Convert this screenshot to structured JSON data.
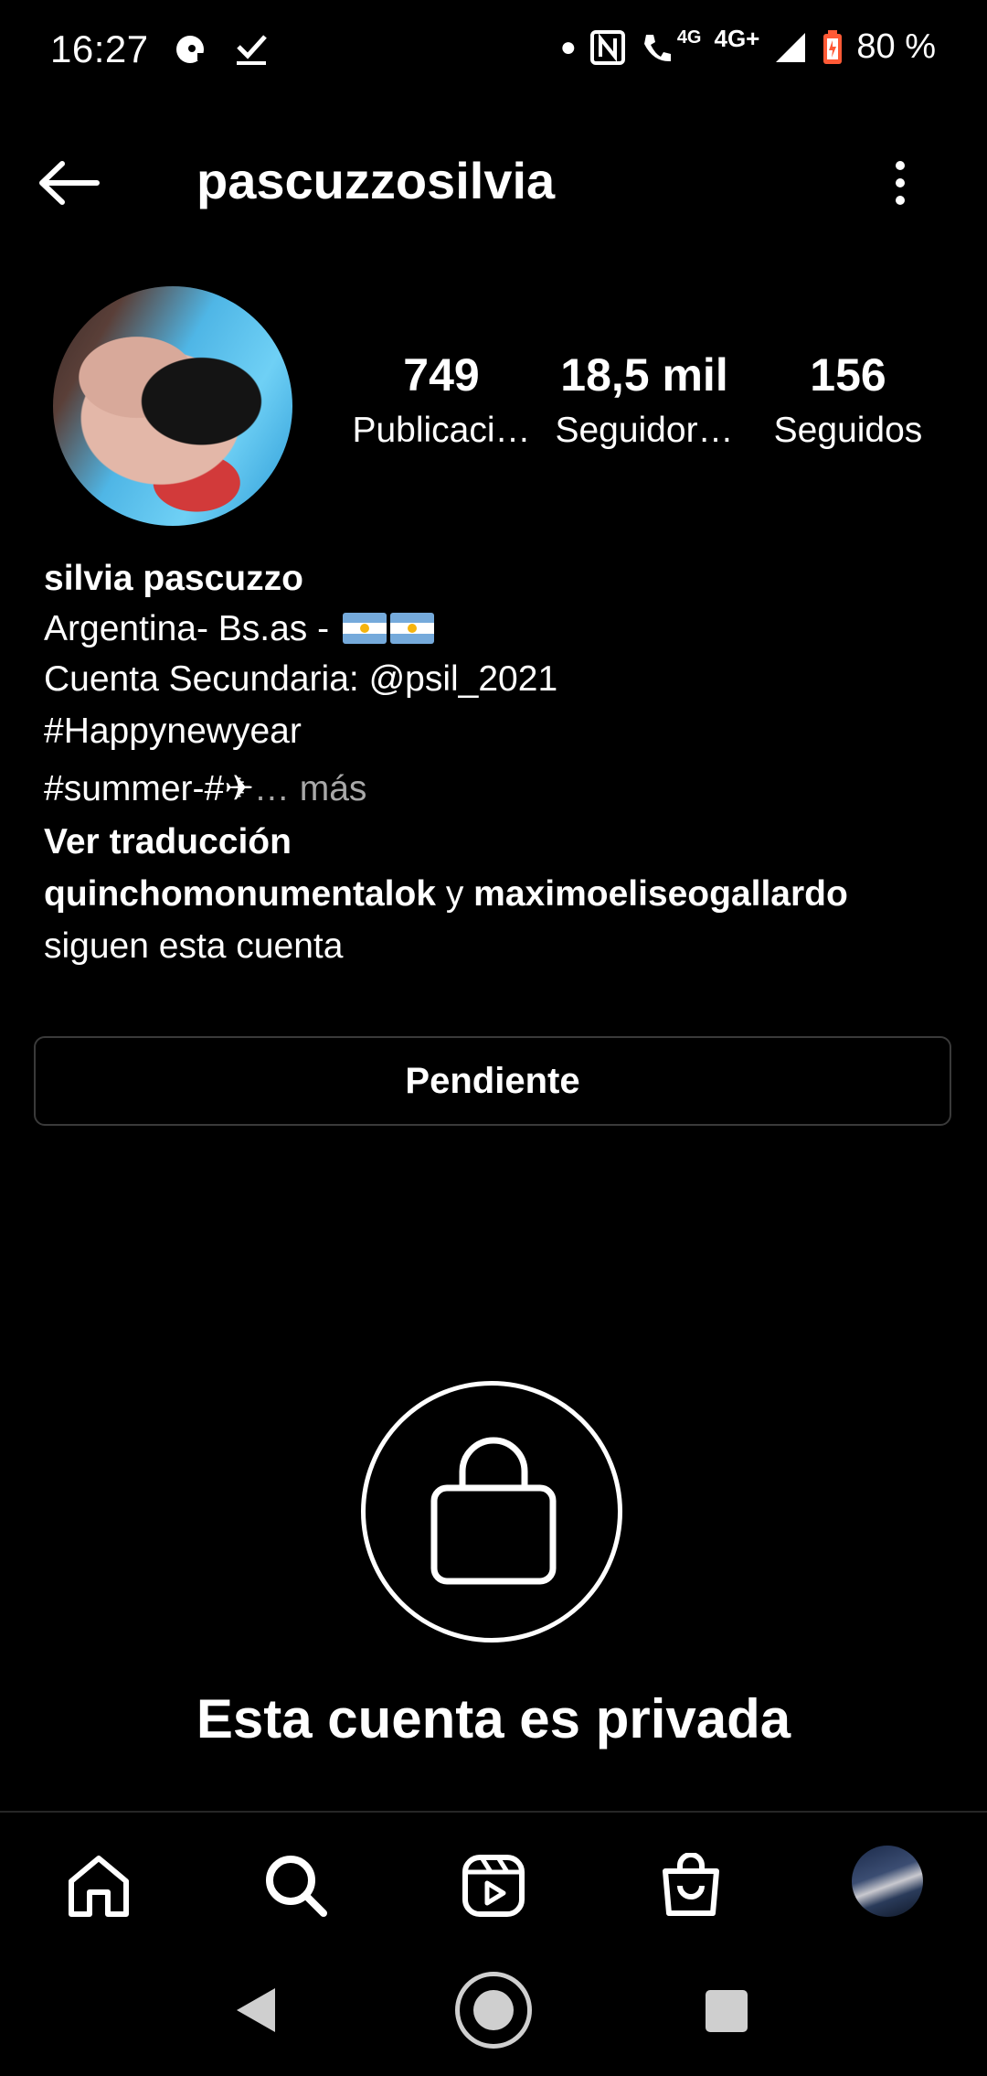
{
  "status_bar": {
    "time": "16:27",
    "network_4g": "4G",
    "network_4gplus": "4G+",
    "battery": "80 %"
  },
  "header": {
    "username": "pascuzzosilvia"
  },
  "stats": [
    {
      "value": "749",
      "label": "Publicaci…"
    },
    {
      "value": "18,5 mil",
      "label": "Seguidor…"
    },
    {
      "value": "156",
      "label": "Seguidos"
    }
  ],
  "bio": {
    "name": "silvia pascuzzo",
    "line1": "Argentina- Bs.as  - ",
    "line2": " Cuenta Secundaria: @psil_2021",
    "line3": "#Happynewyear",
    "line4": "#summer-#✈",
    "more": "… más",
    "translate": "Ver traducción",
    "followed_user1": "quinchomonumentalok",
    "followed_and": " y ",
    "followed_user2": "maximoeliseogallardo",
    "followed_suffix": "siguen esta cuenta"
  },
  "actions": {
    "pending_label": "Pendiente"
  },
  "private": {
    "title": "Esta cuenta es privada"
  },
  "colors": {
    "background": "#000000",
    "muted_text": "#a8a8a8",
    "border": "#3a3a3a"
  }
}
